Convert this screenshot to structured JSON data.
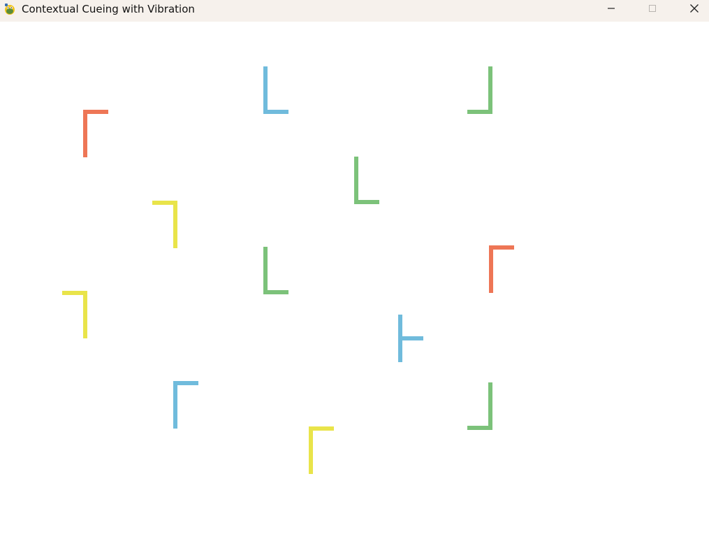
{
  "window": {
    "title": "Contextual Cueing with Vibration"
  },
  "titlebar_buttons": {
    "minimize_icon": "minimize-icon",
    "maximize_icon": "maximize-icon",
    "close_icon": "close-icon"
  },
  "colors": {
    "titlebar": "#f6f1ec",
    "background": "#ffffff",
    "orange": "#ee7656",
    "blue": "#70bbdc",
    "green": "#7cc27a",
    "yellow": "#e9e44a"
  },
  "display": {
    "stimuli": [
      {
        "kind": "L",
        "color": "blue",
        "rotation": 0
      },
      {
        "kind": "L",
        "color": "green",
        "rotation": 90
      },
      {
        "kind": "L",
        "color": "orange",
        "rotation": 270
      },
      {
        "kind": "L",
        "color": "green",
        "rotation": 0
      },
      {
        "kind": "L",
        "color": "yellow",
        "rotation": 180
      },
      {
        "kind": "L",
        "color": "green",
        "rotation": 0
      },
      {
        "kind": "L",
        "color": "orange",
        "rotation": 270
      },
      {
        "kind": "L",
        "color": "yellow",
        "rotation": 180
      },
      {
        "kind": "T",
        "color": "blue",
        "rotation": 0
      },
      {
        "kind": "L",
        "color": "blue",
        "rotation": 270
      },
      {
        "kind": "L",
        "color": "green",
        "rotation": 90
      },
      {
        "kind": "L",
        "color": "yellow",
        "rotation": 270
      }
    ]
  }
}
